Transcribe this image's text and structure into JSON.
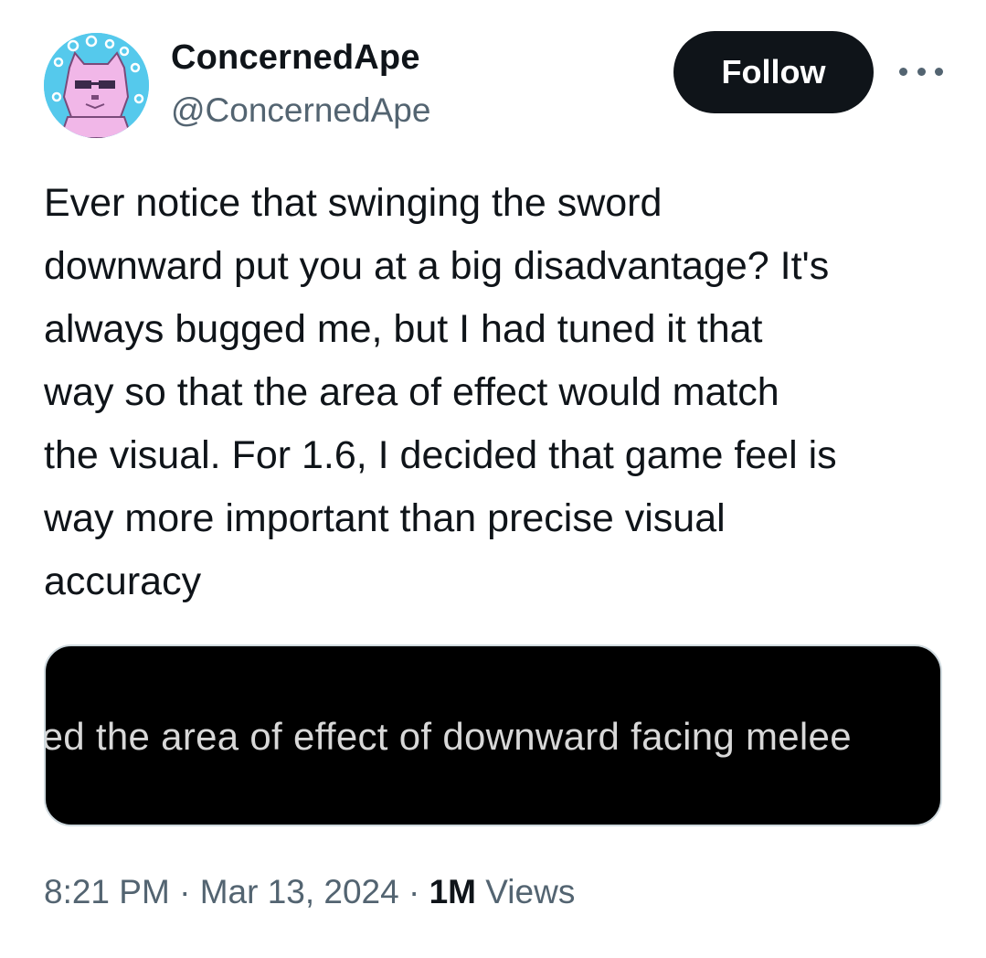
{
  "author": {
    "display_name": "ConcernedApe",
    "handle": "@ConcernedApe",
    "avatar_icon": "pixel-cat-avatar-icon"
  },
  "actions": {
    "follow_label": "Follow",
    "more_icon": "more-horizontal-icon"
  },
  "tweet": {
    "lines": [
      "Ever notice that swinging the sword",
      "downward put you at a big disadvantage? It's",
      "always bugged me, but I had tuned it that",
      "way so that the area of effect would match",
      "the visual. For 1.6, I decided that game feel is",
      "way more important than precise visual",
      "accuracy"
    ]
  },
  "media": {
    "caption_text": "led the area of effect of downward facing melee"
  },
  "meta": {
    "time": "8:21 PM",
    "separator": "·",
    "date": "Mar 13, 2024",
    "views_count": "1M",
    "views_label": "Views"
  },
  "colors": {
    "text_primary": "#0f1419",
    "text_secondary": "#536471",
    "follow_bg": "#0f1419",
    "avatar_bg": "#55c9ec"
  }
}
